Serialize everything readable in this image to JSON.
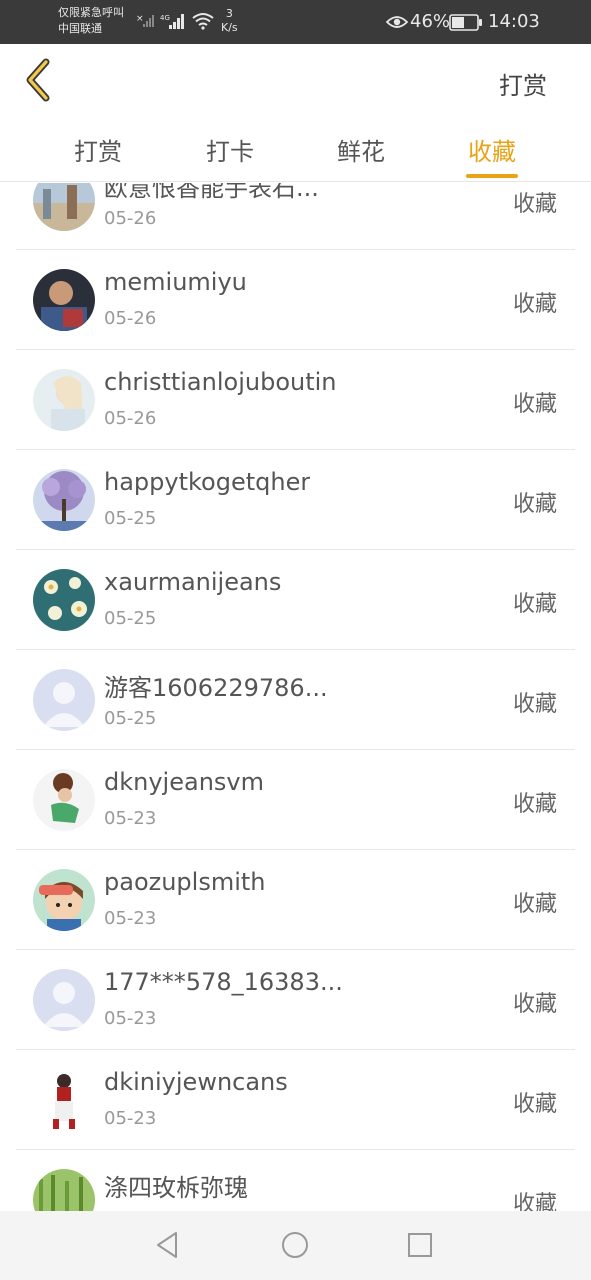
{
  "status_bar": {
    "carrier_line1": "仅限紧急呼叫",
    "carrier_line2": "中国联通",
    "network": "4G",
    "speed_value": "3",
    "speed_unit": "K/s",
    "battery": "46%",
    "time": "14:03"
  },
  "header": {
    "action": "打赏",
    "tabs": [
      {
        "label": "打赏"
      },
      {
        "label": "打卡"
      },
      {
        "label": "鲜花"
      },
      {
        "label": "收藏"
      }
    ],
    "active_tab": "收藏",
    "accent": "#e8a317"
  },
  "list": {
    "items": [
      {
        "name": "欧意恨香能手表石...",
        "date": "05-26",
        "action": "收藏"
      },
      {
        "name": "memiumiyu",
        "date": "05-26",
        "action": "收藏"
      },
      {
        "name": "christtianlojuboutin",
        "date": "05-26",
        "action": "收藏"
      },
      {
        "name": "happytkogetqher",
        "date": "05-25",
        "action": "收藏"
      },
      {
        "name": "xaurmanijeans",
        "date": "05-25",
        "action": "收藏"
      },
      {
        "name": "游客1606229786...",
        "date": "05-25",
        "action": "收藏"
      },
      {
        "name": "dknyjeansvm",
        "date": "05-23",
        "action": "收藏"
      },
      {
        "name": "paozuplsmith",
        "date": "05-23",
        "action": "收藏"
      },
      {
        "name": "177***578_16383...",
        "date": "05-23",
        "action": "收藏"
      },
      {
        "name": "dkiniyjewncans",
        "date": "05-23",
        "action": "收藏"
      },
      {
        "name": "涤四玫柝弥瑰",
        "date": "",
        "action": "收藏"
      }
    ]
  }
}
